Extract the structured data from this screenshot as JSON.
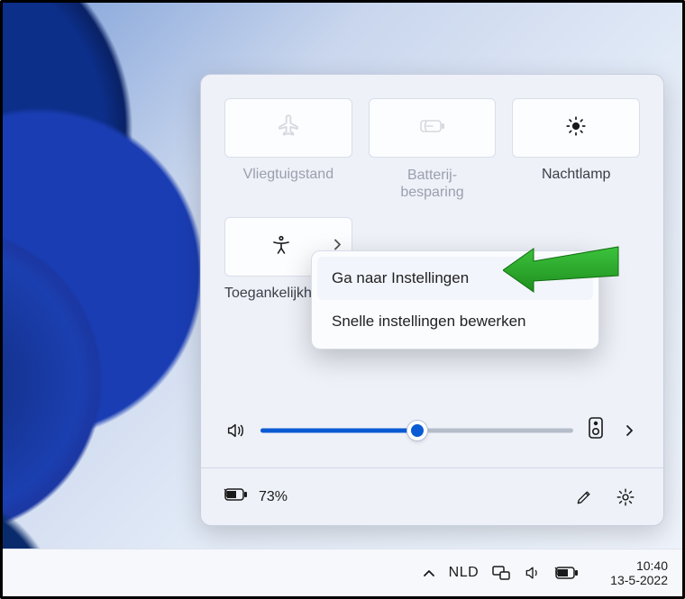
{
  "panel": {
    "tiles": [
      {
        "id": "airplane",
        "label": "Vliegtuigstand",
        "muted": true,
        "disabled": true,
        "hasChevron": false
      },
      {
        "id": "battery",
        "label": "Batterij-\nbesparing",
        "muted": true,
        "disabled": true,
        "hasChevron": false
      },
      {
        "id": "nightlight",
        "label": "Nachtlamp",
        "muted": false,
        "disabled": false,
        "hasChevron": false
      }
    ],
    "tiles_row2": [
      {
        "id": "accessibility",
        "label": "Toegankelijkheid",
        "hasChevron": true
      }
    ],
    "volume": {
      "percent": 50
    },
    "footer": {
      "battery_text": "73%"
    }
  },
  "context_menu": {
    "items": [
      {
        "id": "goto-settings",
        "label": "Ga naar Instellingen",
        "highlight": true
      },
      {
        "id": "edit-quick",
        "label": "Snelle instellingen bewerken",
        "highlight": false
      }
    ]
  },
  "taskbar": {
    "language": "NLD",
    "time": "10:40",
    "date": "13-5-2022"
  },
  "colors": {
    "accent": "#0a5bd3",
    "panel_bg": "#eef1f8",
    "arrow": "#2aa02a"
  }
}
